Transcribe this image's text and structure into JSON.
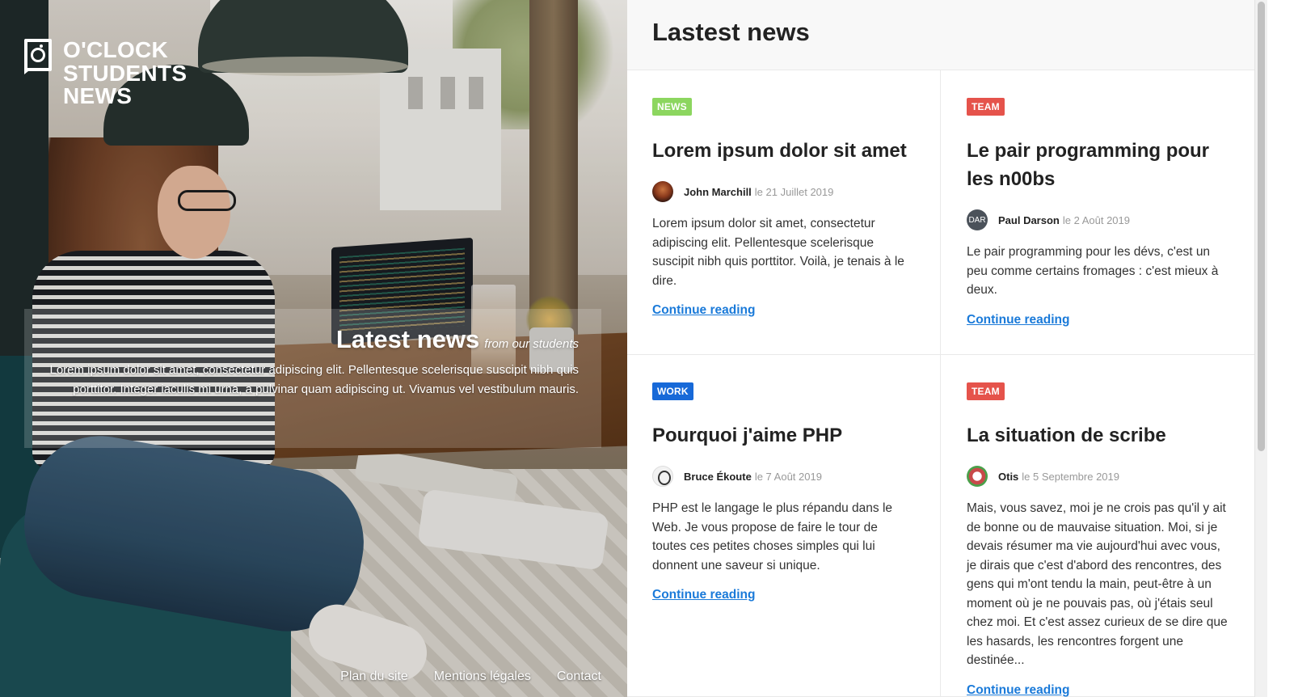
{
  "brand": {
    "name": "O'CLOCK\nSTUDENTS\nNEWS"
  },
  "hero": {
    "title": "Latest news",
    "subtitle": "from our students",
    "text": "Lorem ipsum dolor sit amet, consectetur adipiscing elit. Pellentesque scelerisque suscipit nibh quis porttitor. Integer iaculis mi urna, a pulvinar quam adipiscing ut. Vivamus vel vestibulum mauris."
  },
  "footer": {
    "links": [
      "Plan du site",
      "Mentions légales",
      "Contact"
    ]
  },
  "panel": {
    "title": "Lastest news"
  },
  "posts": [
    {
      "badge": "NEWS",
      "title": "Lorem ipsum dolor sit amet",
      "author": "John Marchill",
      "date": "le 21 Juillet 2019",
      "excerpt": "Lorem ipsum dolor sit amet, consectetur adipiscing elit. Pellentesque scelerisque suscipit nibh quis porttitor. Voilà, je tenais à le dire.",
      "link": "Continue reading"
    },
    {
      "badge": "TEAM",
      "title": "Le pair programming pour les n00bs",
      "author": "Paul Darson",
      "avatar_text": "DAR",
      "date": "le 2 Août 2019",
      "excerpt": "Le pair programming pour les dévs, c'est un peu comme certains fromages : c'est mieux à deux.",
      "link": "Continue reading"
    },
    {
      "badge": "WORK",
      "title": "Pourquoi j'aime PHP",
      "author": "Bruce Ékoute",
      "date": "le 7 Août 2019",
      "excerpt": "PHP est le langage le plus répandu dans le Web. Je vous propose de faire le tour de toutes ces petites choses simples qui lui donnent une saveur si unique.",
      "link": "Continue reading"
    },
    {
      "badge": "TEAM",
      "title": "La situation de scribe",
      "author": "Otis",
      "date": "le 5 Septembre 2019",
      "excerpt": "Mais, vous savez, moi je ne crois pas qu'il y ait de bonne ou de mauvaise situation. Moi, si je devais résumer ma vie aujourd'hui avec vous, je dirais que c'est d'abord des rencontres, des gens qui m'ont tendu la main, peut-être à un moment où je ne pouvais pas, où j'étais seul chez moi. Et c'est assez curieux de se dire que les hasards, les rencontres forgent une destinée...",
      "link": "Continue reading"
    }
  ],
  "colors": {
    "news": "#8cd65f",
    "team": "#e5534b",
    "work": "#1769d8",
    "link": "#1a7ad9"
  }
}
